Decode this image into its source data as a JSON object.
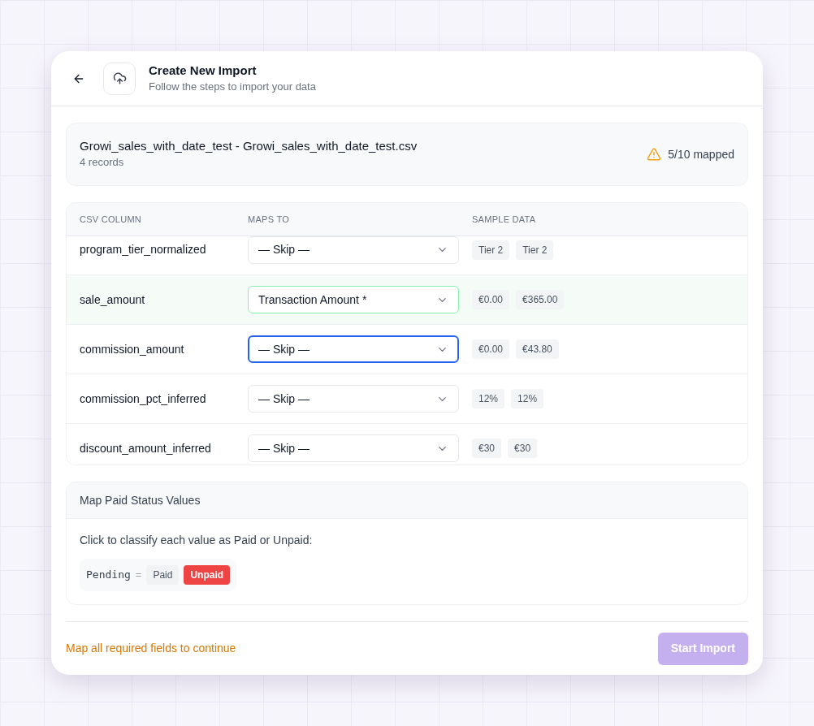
{
  "header": {
    "title": "Create New Import",
    "subtitle": "Follow the steps to import your data"
  },
  "file": {
    "name": "Growi_sales_with_date_test - Growi_sales_with_date_test.csv",
    "records": "4 records",
    "mapped": "5/10 mapped"
  },
  "table": {
    "columns": [
      "CSV COLUMN",
      "MAPS TO",
      "SAMPLE DATA"
    ],
    "rows": [
      {
        "column": "program_tier_normalized",
        "maps_to": "— Skip —",
        "mapped": false,
        "focused": false,
        "samples": [
          "Tier 2",
          "Tier 2"
        ]
      },
      {
        "column": "sale_amount",
        "maps_to": "Transaction Amount *",
        "mapped": true,
        "focused": false,
        "samples": [
          "€0.00",
          "€365.00"
        ]
      },
      {
        "column": "commission_amount",
        "maps_to": "— Skip —",
        "mapped": false,
        "focused": true,
        "samples": [
          "€0.00",
          "€43.80"
        ]
      },
      {
        "column": "commission_pct_inferred",
        "maps_to": "— Skip —",
        "mapped": false,
        "focused": false,
        "samples": [
          "12%",
          "12%"
        ]
      },
      {
        "column": "discount_amount_inferred",
        "maps_to": "— Skip —",
        "mapped": false,
        "focused": false,
        "samples": [
          "€30",
          "€30"
        ]
      }
    ]
  },
  "paid_status": {
    "title": "Map Paid Status Values",
    "instruction": "Click to classify each value as Paid or Unpaid:",
    "values": [
      {
        "value": "Pending",
        "equals": "=",
        "options": [
          {
            "label": "Paid",
            "selected": false
          },
          {
            "label": "Unpaid",
            "selected": true
          }
        ]
      }
    ]
  },
  "footer": {
    "message": "Map all required fields to continue",
    "button": "Start Import",
    "button_disabled": true
  }
}
